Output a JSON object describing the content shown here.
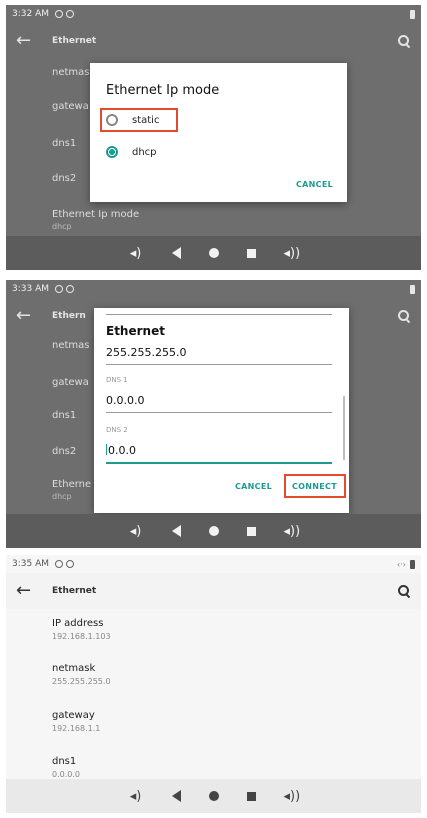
{
  "screens": [
    {
      "status": {
        "time": "3:32 AM"
      },
      "toolbar": {
        "title": "Ethernet"
      },
      "list": [
        {
          "label": "netmas"
        },
        {
          "label": "gatewa"
        },
        {
          "label": "dns1"
        },
        {
          "label": "dns2"
        },
        {
          "label": "Ethernet Ip mode",
          "value": "dhcp"
        }
      ],
      "dialog": {
        "title": "Ethernet Ip mode",
        "options": [
          {
            "label": "static",
            "selected": false
          },
          {
            "label": "dhcp",
            "selected": true
          }
        ],
        "cancel": "CANCEL"
      }
    },
    {
      "status": {
        "time": "3:33 AM"
      },
      "toolbar": {
        "title": "Ethern"
      },
      "list": [
        {
          "label": "netmas"
        },
        {
          "label": "gatewa"
        },
        {
          "label": "dns1"
        },
        {
          "label": "dns2"
        },
        {
          "label": "Etherne",
          "value": "dhcp"
        }
      ],
      "dialog": {
        "title": "Ethernet",
        "netmask_value": "255.255.255.0",
        "dns1_label": "DNS 1",
        "dns1_value": "0.0.0.0",
        "dns2_label": "DNS 2",
        "dns2_value": "0.0.0.0",
        "dns2_cursor_text": "0.0.0",
        "cancel": "CANCEL",
        "connect": "CONNECT"
      }
    },
    {
      "status": {
        "time": "3:35 AM"
      },
      "toolbar": {
        "title": "Ethernet"
      },
      "details": [
        {
          "label": "IP address",
          "value": "192.168.1.103"
        },
        {
          "label": "netmask",
          "value": "255.255.255.0"
        },
        {
          "label": "gateway",
          "value": "192.168.1.1"
        },
        {
          "label": "dns1",
          "value": "0.0.0.0"
        }
      ]
    }
  ],
  "icons": {
    "back": "arrow-left-icon",
    "search": "search-icon",
    "volume_down": "volume-down-icon",
    "back_nav": "triangle-back-icon",
    "home": "circle-home-icon",
    "recents": "square-recents-icon",
    "volume_up": "volume-up-icon"
  },
  "colors": {
    "accent": "#1b9c8f",
    "highlight": "#e24c2c",
    "dim_background": "#6e6e6e"
  }
}
